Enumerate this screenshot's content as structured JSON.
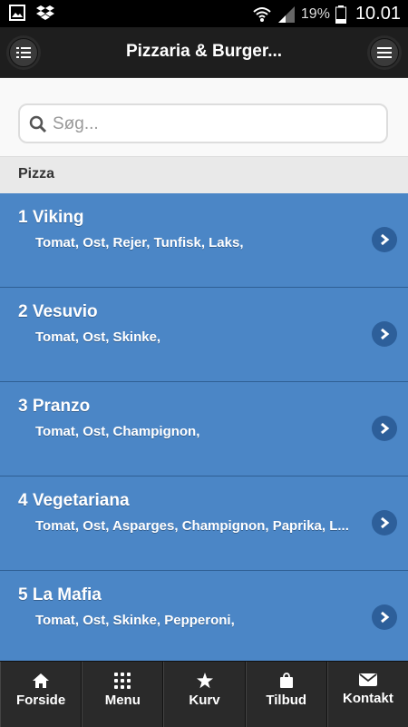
{
  "status_bar": {
    "battery_percent": "19%",
    "time": "10.01",
    "icons": [
      "image-icon",
      "dropbox-icon",
      "wifi-icon",
      "signal-icon",
      "battery-icon"
    ]
  },
  "header": {
    "title": "Pizzaria & Burger...",
    "left_button_icon": "list-icon",
    "right_button_icon": "menu-icon"
  },
  "search": {
    "placeholder": "Søg...",
    "value": ""
  },
  "section": {
    "title": "Pizza"
  },
  "items": [
    {
      "name": "1 Viking",
      "ingredients": "Tomat, Ost, Rejer, Tunfisk, Laks,"
    },
    {
      "name": "2 Vesuvio",
      "ingredients": "Tomat, Ost, Skinke,"
    },
    {
      "name": "3 Pranzo",
      "ingredients": "Tomat, Ost, Champignon,"
    },
    {
      "name": "4 Vegetariana",
      "ingredients": "Tomat, Ost, Asparges, Champignon, Paprika, L..."
    },
    {
      "name": "5 La Mafia",
      "ingredients": "Tomat, Ost, Skinke, Pepperoni,"
    }
  ],
  "tabs": [
    {
      "label": "Forside",
      "icon": "home-icon"
    },
    {
      "label": "Menu",
      "icon": "grid-icon"
    },
    {
      "label": "Kurv",
      "icon": "star-icon"
    },
    {
      "label": "Tilbud",
      "icon": "bag-icon"
    },
    {
      "label": "Kontakt",
      "icon": "envelope-icon"
    }
  ],
  "colors": {
    "list_item_bg": "#4b86c6",
    "header_bg": "#1e1e1e",
    "tabbar_bg": "#2a2a2a"
  }
}
